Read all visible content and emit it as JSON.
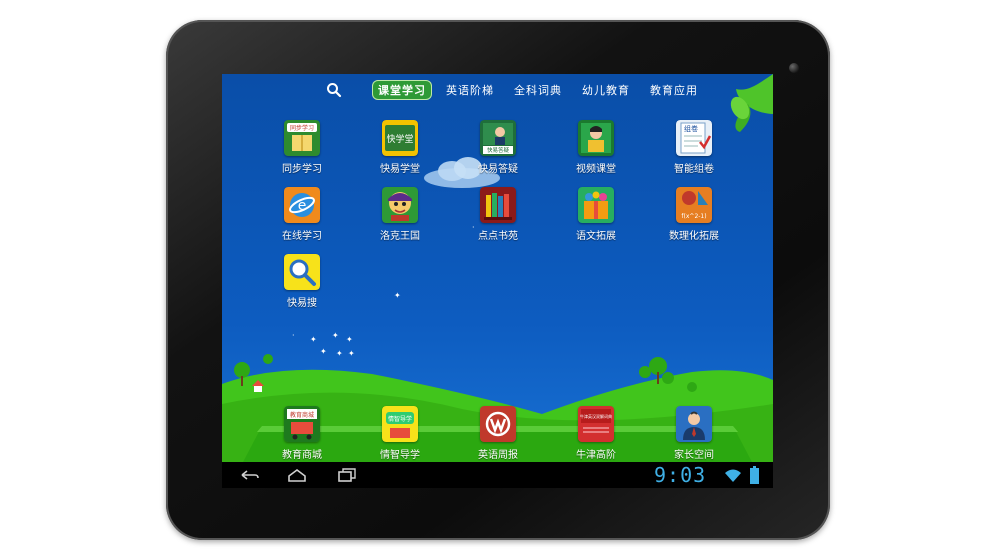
{
  "topbar": {
    "tabs": [
      {
        "label": "课堂学习",
        "active": true
      },
      {
        "label": "英语阶梯",
        "active": false
      },
      {
        "label": "全科词典",
        "active": false
      },
      {
        "label": "幼儿教育",
        "active": false
      },
      {
        "label": "教育应用",
        "active": false
      }
    ]
  },
  "apps": [
    {
      "label": "同步学习",
      "icon_text": "同步学习",
      "icon": "book-icon"
    },
    {
      "label": "快易学堂",
      "icon_text": "快学堂",
      "icon": "chalkboard-icon"
    },
    {
      "label": "快易答疑",
      "icon_text": "快易答疑",
      "icon": "teacher-icon"
    },
    {
      "label": "视频课堂",
      "icon_text": "",
      "icon": "video-class-icon"
    },
    {
      "label": "智能组卷",
      "icon_text": "组卷",
      "icon": "test-paper-icon"
    },
    {
      "label": "在线学习",
      "icon_text": "",
      "icon": "globe-icon"
    },
    {
      "label": "洛克王国",
      "icon_text": "",
      "icon": "game-character-icon"
    },
    {
      "label": "点点书苑",
      "icon_text": "",
      "icon": "bookshelf-icon"
    },
    {
      "label": "语文拓展",
      "icon_text": "",
      "icon": "gift-box-icon"
    },
    {
      "label": "数理化拓展",
      "icon_text": "f(x^2-1)",
      "icon": "math-icon"
    },
    {
      "label": "快易搜",
      "icon_text": "",
      "icon": "magnifier-icon"
    }
  ],
  "dock": [
    {
      "label": "教育商城",
      "icon_text": "教育商城",
      "icon": "shopping-cart-icon"
    },
    {
      "label": "情智导学",
      "icon_text": "情智导学",
      "icon": "guide-icon"
    },
    {
      "label": "英语周报",
      "icon_text": "",
      "icon": "newspaper-icon"
    },
    {
      "label": "牛津高阶",
      "icon_text": "牛津英汉双解词典",
      "icon": "dictionary-icon"
    },
    {
      "label": "家长空间",
      "icon_text": "",
      "icon": "parent-icon"
    }
  ],
  "status": {
    "time": "9:03"
  },
  "colors": {
    "sky": "#0b52b0",
    "hill": "#3cc21a",
    "active_tab": "#2e9a36",
    "clock": "#3fb0e6"
  }
}
